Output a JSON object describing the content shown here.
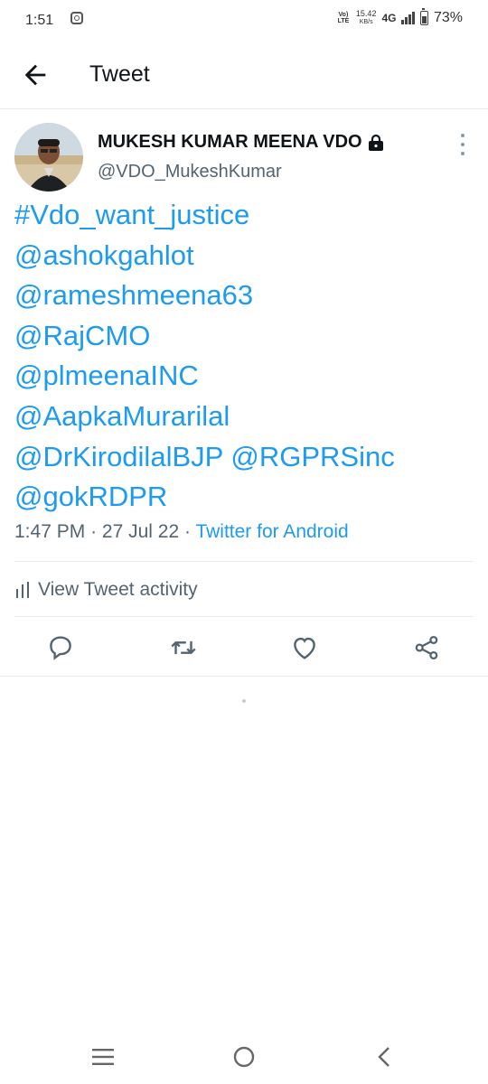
{
  "status_bar": {
    "time": "1:51",
    "volte": "Vo) LTE",
    "speed_value": "15.42",
    "speed_unit": "KB/s",
    "network": "4G",
    "battery_pct": "73%",
    "battery_level": 0.73
  },
  "app_bar": {
    "title": "Tweet",
    "back_icon": "arrow-left-icon"
  },
  "tweet": {
    "author_name": "MUKESH KUMAR MEENA VDO",
    "handle": "@VDO_MukeshKumar",
    "lines": [
      [
        "#Vdo_want_justice"
      ],
      [
        "@ashokgahlot"
      ],
      [
        "@rameshmeena63"
      ],
      [
        "@RajCMO"
      ],
      [
        "@plmeenaINC"
      ],
      [
        "@AapkaMurarilal"
      ],
      [
        "@DrKirodilalBJP",
        "@RGPRSinc"
      ],
      [
        "@gokRDPR"
      ]
    ],
    "time": "1:47 PM",
    "date": "27 Jul 22",
    "separator": "·",
    "source": "Twitter for Android",
    "activity_label": "View Tweet activity"
  },
  "actions": [
    {
      "name": "reply",
      "icon": "reply-icon"
    },
    {
      "name": "retweet",
      "icon": "retweet-icon"
    },
    {
      "name": "like",
      "icon": "heart-icon"
    },
    {
      "name": "share",
      "icon": "share-icon"
    }
  ],
  "colors": {
    "link": "#1d9bf0",
    "text": "#0f1419",
    "secondary": "#536471",
    "divider": "#e6ecf0"
  }
}
